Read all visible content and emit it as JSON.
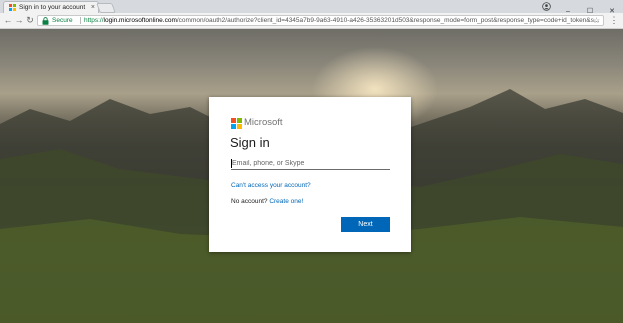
{
  "browser": {
    "tab": {
      "title": "Sign in to your account",
      "close_glyph": "×",
      "favicon": "microsoft-favicon"
    },
    "window_controls": {
      "minimize": "–",
      "maximize": "☐",
      "close": "✕"
    },
    "nav": {
      "back": "←",
      "forward": "→",
      "reload": "↻"
    },
    "address": {
      "security_label": "Secure",
      "scheme": "https://",
      "host": "login.microsoftonline.com",
      "path": "/common/oauth2/authorize?client_id=4345a7b9-9a63-4910-a426-35363201d503&response_mode=form_post&response_type=code+id_token&s...",
      "star_glyph": "☆"
    },
    "menu_glyph": "⋮"
  },
  "signin": {
    "brand": "Microsoft",
    "heading": "Sign in",
    "email_placeholder": "Email, phone, or Skype",
    "email_value": "",
    "cant_access_link": "Can't access your account?",
    "no_account_text": "No account?",
    "create_link": "Create one!",
    "next_label": "Next"
  },
  "colors": {
    "ms_red": "#f25022",
    "ms_green": "#7fba00",
    "ms_blue": "#00a4ef",
    "ms_yellow": "#ffb900",
    "accent_blue": "#0067b8",
    "secure_green": "#0b8043"
  }
}
